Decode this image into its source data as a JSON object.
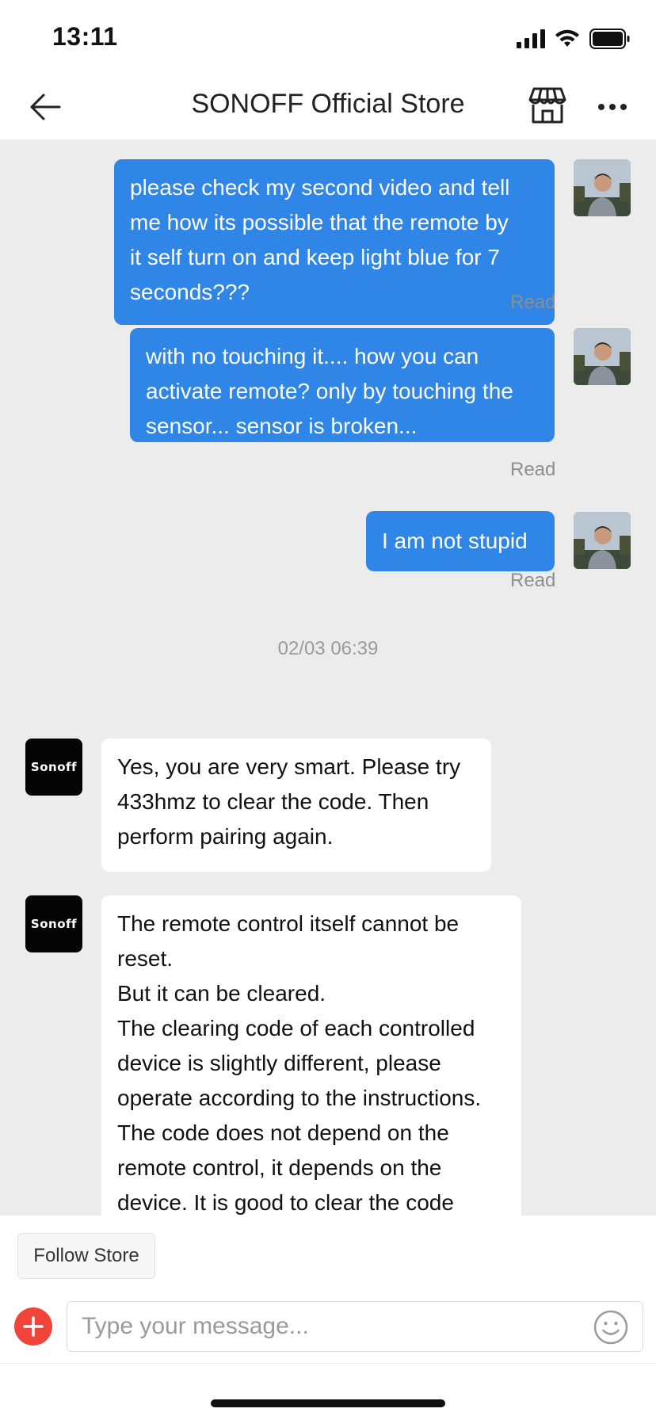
{
  "status_bar": {
    "time": "13:11"
  },
  "nav": {
    "title": "SONOFF Official Store"
  },
  "store_avatar_text": "Sonoff",
  "messages": [
    {
      "direction": "out",
      "lines": [
        "please check my second video and tell",
        "me how its possible that the remote by",
        "it self turn on and keep light blue for 7",
        "seconds???"
      ],
      "status": "Read"
    },
    {
      "direction": "out",
      "lines": [
        "with no touching it.... how you can",
        "activate remote? only by touching the",
        "sensor... sensor is broken..."
      ],
      "status": "Read"
    },
    {
      "direction": "out",
      "lines": [
        "I am not stupid"
      ],
      "status": "Read"
    },
    {
      "direction": "in",
      "lines": [
        "Yes, you are very smart. Please try",
        "433hmz to clear the code. Then",
        "perform pairing again."
      ]
    },
    {
      "direction": "in",
      "lines": [
        "The remote control itself cannot be",
        "reset.",
        "But it can be cleared.",
        "The clearing code of each controlled",
        "device is slightly different, please",
        "operate according to the instructions.",
        "The code does not depend on the",
        "remote control, it depends on the",
        "device. It is good to clear the code"
      ]
    }
  ],
  "timestamp": "02/03 06:39",
  "bottom": {
    "follow_label": "Follow Store",
    "input_placeholder": "Type your message..."
  },
  "colors": {
    "outgoing_bubble": "#2f86e6",
    "incoming_bubble": "#ffffff",
    "chat_background": "#ececec",
    "plus_button": "#f0433a"
  }
}
